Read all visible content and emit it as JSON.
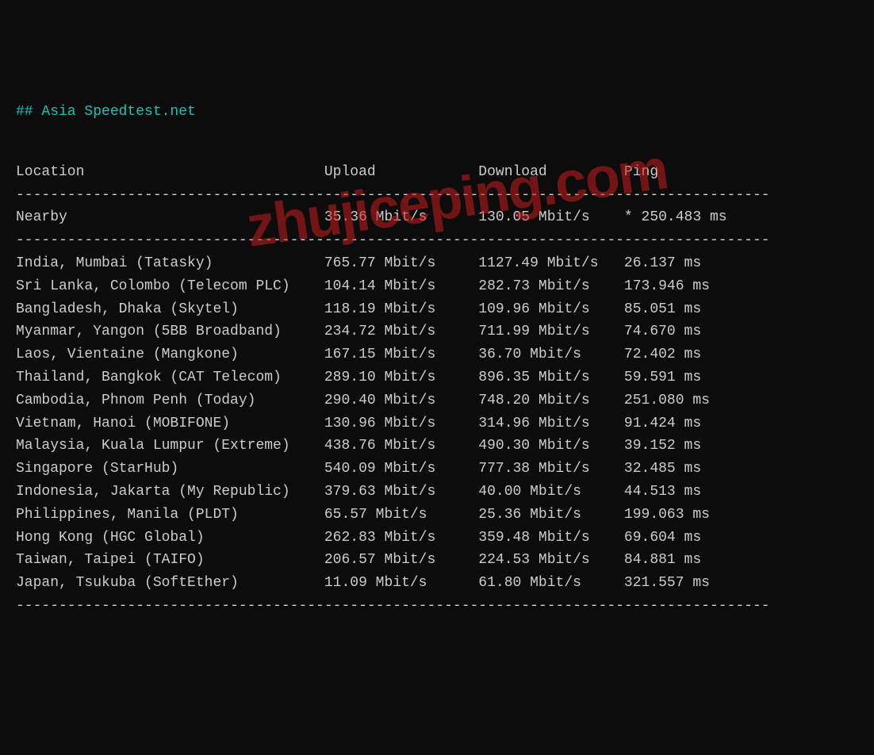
{
  "title": "## Asia Speedtest.net",
  "headers": {
    "location": "Location",
    "upload": "Upload",
    "download": "Download",
    "ping": "Ping"
  },
  "nearby": {
    "location": "Nearby",
    "upload": "35.36 Mbit/s",
    "download": "130.05 Mbit/s",
    "ping": "* 250.483 ms"
  },
  "rows": [
    {
      "location": "India, Mumbai (Tatasky)",
      "upload": "765.77 Mbit/s",
      "download": "1127.49 Mbit/s",
      "ping": "26.137 ms"
    },
    {
      "location": "Sri Lanka, Colombo (Telecom PLC)",
      "upload": "104.14 Mbit/s",
      "download": "282.73 Mbit/s",
      "ping": "173.946 ms"
    },
    {
      "location": "Bangladesh, Dhaka (Skytel)",
      "upload": "118.19 Mbit/s",
      "download": "109.96 Mbit/s",
      "ping": "85.051 ms"
    },
    {
      "location": "Myanmar, Yangon (5BB Broadband)",
      "upload": "234.72 Mbit/s",
      "download": "711.99 Mbit/s",
      "ping": "74.670 ms"
    },
    {
      "location": "Laos, Vientaine (Mangkone)",
      "upload": "167.15 Mbit/s",
      "download": "36.70 Mbit/s",
      "ping": "72.402 ms"
    },
    {
      "location": "Thailand, Bangkok (CAT Telecom)",
      "upload": "289.10 Mbit/s",
      "download": "896.35 Mbit/s",
      "ping": "59.591 ms"
    },
    {
      "location": "Cambodia, Phnom Penh (Today)",
      "upload": "290.40 Mbit/s",
      "download": "748.20 Mbit/s",
      "ping": "251.080 ms"
    },
    {
      "location": "Vietnam, Hanoi (MOBIFONE)",
      "upload": "130.96 Mbit/s",
      "download": "314.96 Mbit/s",
      "ping": "91.424 ms"
    },
    {
      "location": "Malaysia, Kuala Lumpur (Extreme)",
      "upload": "438.76 Mbit/s",
      "download": "490.30 Mbit/s",
      "ping": "39.152 ms"
    },
    {
      "location": "Singapore (StarHub)",
      "upload": "540.09 Mbit/s",
      "download": "777.38 Mbit/s",
      "ping": "32.485 ms"
    },
    {
      "location": "Indonesia, Jakarta (My Republic)",
      "upload": "379.63 Mbit/s",
      "download": "40.00 Mbit/s",
      "ping": "44.513 ms"
    },
    {
      "location": "Philippines, Manila (PLDT)",
      "upload": "65.57 Mbit/s",
      "download": "25.36 Mbit/s",
      "ping": "199.063 ms"
    },
    {
      "location": "Hong Kong (HGC Global)",
      "upload": "262.83 Mbit/s",
      "download": "359.48 Mbit/s",
      "ping": "69.604 ms"
    },
    {
      "location": "Taiwan, Taipei (TAIFO)",
      "upload": "206.57 Mbit/s",
      "download": "224.53 Mbit/s",
      "ping": "84.881 ms"
    },
    {
      "location": "Japan, Tsukuba (SoftEther)",
      "upload": "11.09 Mbit/s",
      "download": "61.80 Mbit/s",
      "ping": "321.557 ms"
    }
  ],
  "watermark": "zhujiceping.com"
}
